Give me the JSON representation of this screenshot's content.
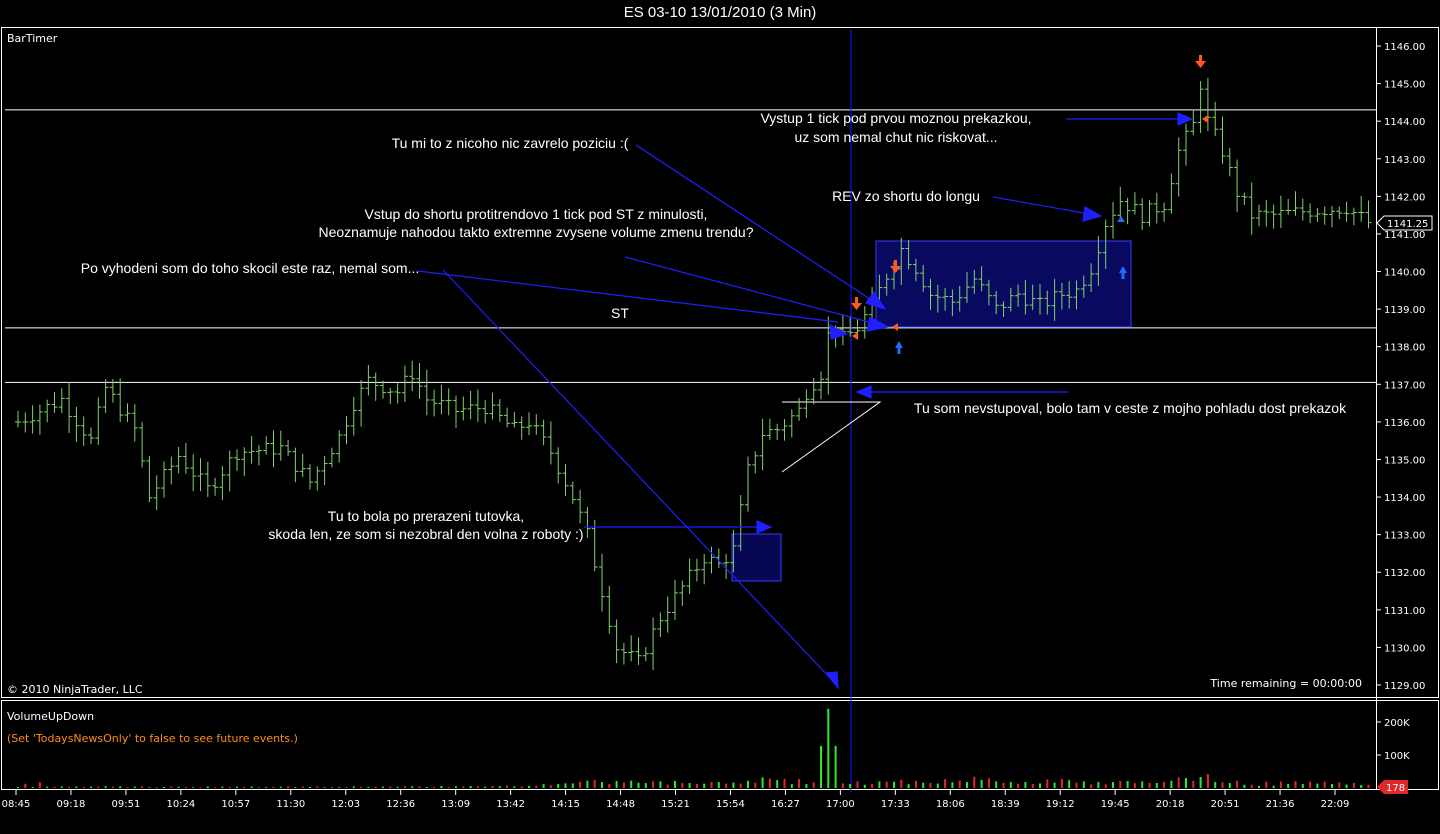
{
  "window": {
    "title": "ES 03-10  13/01/2010 (3 Min)"
  },
  "price_panel": {
    "indicator_label": "BarTimer",
    "copyright": "© 2010 NinjaTrader, LLC",
    "time_remaining": "Time remaining = 00:00:00",
    "current_price": "1141.25"
  },
  "volume_panel": {
    "indicator_label": "VolumeUpDown",
    "news_note": "(Set 'TodaysNewsOnly' to false to see future events.)",
    "last_volume": "178",
    "y_ticks": [
      "200K",
      "100K"
    ]
  },
  "annotations": [
    "Vystup 1 tick pod prvou moznou prekazkou,",
    "uz som nemal chut nic riskovat...",
    "Tu mi to z nicoho nic zavrelo poziciu :(",
    "REV zo shortu do longu",
    "Vstup do shortu protitrendovo 1 tick pod ST z minulosti,",
    "Neoznamuje nahodou takto extremne zvysene volume zmenu trendu?",
    "Po vyhodeni som do toho skocil este raz, nemal som...",
    "ST",
    "Tu som nevstupoval, bolo tam v ceste z mojho pohladu dost prekazok",
    "Tu to bola po prerazeni tutovka,",
    "skoda len, ze som si nezobral den volna z roboty :)"
  ],
  "colors": {
    "background": "#000000",
    "up_bar": "#7dd36a",
    "volume_up": "#2ee82e",
    "volume_down": "#e02828",
    "arrow_blue": "#1f1fff",
    "marker_orange": "#ff5a1e",
    "box_fill": "#0a0a70",
    "panel_border": "#ffffff"
  },
  "chart_data": {
    "type": "ohlc",
    "symbol": "ES 03-10",
    "date": "13/01/2010",
    "interval": "3 Min",
    "y_range": [
      1129.0,
      1146.0
    ],
    "y_ticks": [
      "1146.00",
      "1145.00",
      "1144.00",
      "1143.00",
      "1142.00",
      "1141.00",
      "1140.00",
      "1139.00",
      "1138.00",
      "1137.00",
      "1136.00",
      "1135.00",
      "1134.00",
      "1133.00",
      "1132.00",
      "1131.00",
      "1130.00",
      "1129.00"
    ],
    "x_ticks": [
      "08:45",
      "09:18",
      "09:51",
      "10:24",
      "10:57",
      "11:30",
      "12:03",
      "12:36",
      "13:09",
      "13:42",
      "14:15",
      "14:48",
      "15:21",
      "15:54",
      "16:27",
      "17:00",
      "17:33",
      "18:06",
      "18:39",
      "19:12",
      "19:45",
      "20:18",
      "20:51",
      "21:36",
      "22:09"
    ],
    "horizontal_levels": [
      1144.3,
      1138.5,
      1137.05
    ],
    "last_price": 1141.25,
    "price_path": [
      [
        0,
        1136.0
      ],
      [
        6,
        1136.6
      ],
      [
        10,
        1135.5
      ],
      [
        12,
        1136.9
      ],
      [
        16,
        1135.8
      ],
      [
        18,
        1134.0
      ],
      [
        22,
        1135.1
      ],
      [
        26,
        1134.2
      ],
      [
        30,
        1135.2
      ],
      [
        36,
        1135.3
      ],
      [
        40,
        1134.4
      ],
      [
        44,
        1135.6
      ],
      [
        46,
        1136.5
      ],
      [
        48,
        1137.1
      ],
      [
        52,
        1136.8
      ],
      [
        54,
        1137.3
      ],
      [
        56,
        1136.6
      ],
      [
        60,
        1136.3
      ],
      [
        64,
        1136.4
      ],
      [
        68,
        1135.8
      ],
      [
        70,
        1136.0
      ],
      [
        73,
        1135.2
      ],
      [
        76,
        1134.0
      ],
      [
        78,
        1133.0
      ],
      [
        80,
        1131.5
      ],
      [
        82,
        1130.0
      ],
      [
        85,
        1129.6
      ],
      [
        88,
        1130.8
      ],
      [
        91,
        1131.6
      ],
      [
        94,
        1132.4
      ],
      [
        96,
        1132.2
      ],
      [
        98,
        1132.6
      ],
      [
        100,
        1134.7
      ],
      [
        102,
        1135.7
      ],
      [
        104,
        1135.8
      ],
      [
        107,
        1136.3
      ],
      [
        108,
        1136.8
      ],
      [
        110,
        1137.3
      ],
      [
        111,
        1138.3
      ],
      [
        112,
        1138.6
      ],
      [
        113,
        1138.2
      ],
      [
        115,
        1138.5
      ],
      [
        117,
        1139.1
      ],
      [
        119,
        1139.9
      ],
      [
        121,
        1140.6
      ],
      [
        123,
        1140.1
      ],
      [
        125,
        1139.4
      ],
      [
        128,
        1139.2
      ],
      [
        131,
        1139.8
      ],
      [
        134,
        1139.0
      ],
      [
        137,
        1139.4
      ],
      [
        140,
        1139.1
      ],
      [
        143,
        1139.4
      ],
      [
        145,
        1139.5
      ],
      [
        147,
        1140.1
      ],
      [
        149,
        1141.3
      ],
      [
        151,
        1141.9
      ],
      [
        154,
        1141.5
      ],
      [
        157,
        1141.8
      ],
      [
        159,
        1143.2
      ],
      [
        161,
        1143.9
      ],
      [
        162,
        1145.0
      ],
      [
        163,
        1144.0
      ],
      [
        165,
        1143.2
      ],
      [
        167,
        1142.1
      ],
      [
        169,
        1141.5
      ],
      [
        172,
        1141.5
      ],
      [
        176,
        1141.6
      ],
      [
        182,
        1141.7
      ],
      [
        185,
        1141.3
      ]
    ],
    "volume_up": [
      [
        0,
        3
      ],
      [
        10,
        4
      ],
      [
        20,
        3
      ],
      [
        30,
        4
      ],
      [
        40,
        3
      ],
      [
        50,
        4
      ],
      [
        60,
        5
      ],
      [
        70,
        6
      ],
      [
        75,
        14
      ],
      [
        80,
        18
      ],
      [
        85,
        16
      ],
      [
        88,
        20
      ],
      [
        92,
        15
      ],
      [
        96,
        18
      ],
      [
        100,
        22
      ],
      [
        104,
        24
      ],
      [
        108,
        12
      ],
      [
        111,
        240
      ],
      [
        114,
        12
      ],
      [
        118,
        20
      ],
      [
        124,
        16
      ],
      [
        130,
        18
      ],
      [
        134,
        20
      ],
      [
        138,
        18
      ],
      [
        142,
        16
      ],
      [
        146,
        20
      ],
      [
        150,
        18
      ],
      [
        154,
        20
      ],
      [
        158,
        22
      ],
      [
        160,
        30
      ],
      [
        164,
        18
      ],
      [
        168,
        10
      ]
    ],
    "volume_down": [
      [
        5,
        3
      ],
      [
        15,
        4
      ],
      [
        25,
        3
      ],
      [
        35,
        4
      ],
      [
        45,
        3
      ],
      [
        55,
        4
      ],
      [
        65,
        5
      ],
      [
        72,
        8
      ],
      [
        77,
        16
      ],
      [
        82,
        20
      ],
      [
        86,
        22
      ],
      [
        90,
        14
      ],
      [
        94,
        16
      ],
      [
        98,
        18
      ],
      [
        102,
        20
      ],
      [
        106,
        26
      ],
      [
        110,
        14
      ],
      [
        113,
        16
      ],
      [
        116,
        14
      ],
      [
        120,
        18
      ],
      [
        126,
        22
      ],
      [
        132,
        26
      ],
      [
        136,
        18
      ],
      [
        140,
        20
      ],
      [
        144,
        22
      ],
      [
        148,
        16
      ],
      [
        152,
        18
      ],
      [
        156,
        20
      ],
      [
        161,
        28
      ],
      [
        163,
        32
      ],
      [
        166,
        16
      ]
    ]
  }
}
